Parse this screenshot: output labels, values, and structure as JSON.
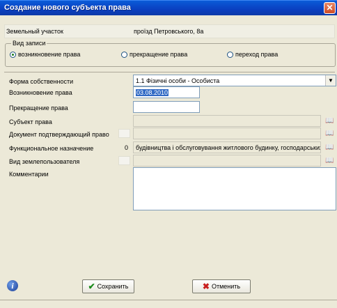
{
  "window": {
    "title": "Создание нового субъекта права",
    "close_glyph": "✕"
  },
  "land_plot": {
    "label": "Земельный участок",
    "value": "проїзд Петровського, 8а"
  },
  "record_type": {
    "legend": "Вид записи",
    "options": [
      {
        "label": "возникновение права",
        "selected": true
      },
      {
        "label": "прекращение права",
        "selected": false
      },
      {
        "label": "переход права",
        "selected": false
      }
    ]
  },
  "form": {
    "ownership": {
      "label": "Форма собственности",
      "value": "1.1 Фізичні особи - Особиста",
      "dropdown_glyph": "▼"
    },
    "right_start": {
      "label": "Возникновение права",
      "value": "03.08.2010"
    },
    "right_end": {
      "label": "Прекращение права",
      "value": ""
    },
    "subject": {
      "label": "Субъект права",
      "value": ""
    },
    "document": {
      "label": "Документ подтверждающий право",
      "value": ""
    },
    "purpose": {
      "label": "Функциональное назначение",
      "code": "0",
      "value": "будівництва і обслуговування житлового будинку, господарських"
    },
    "user_type": {
      "label": "Вид землепользователя",
      "value": ""
    },
    "comments": {
      "label": "Комментарии"
    }
  },
  "buttons": {
    "save": {
      "label": "Сохранить",
      "icon": "check-icon"
    },
    "cancel": {
      "label": "Отменить",
      "icon": "cross-icon"
    }
  },
  "icons": {
    "lookup": "book-icon",
    "info": "info-icon"
  },
  "colors": {
    "titlebar": "#0a46c8",
    "selection": "#316ac5"
  }
}
